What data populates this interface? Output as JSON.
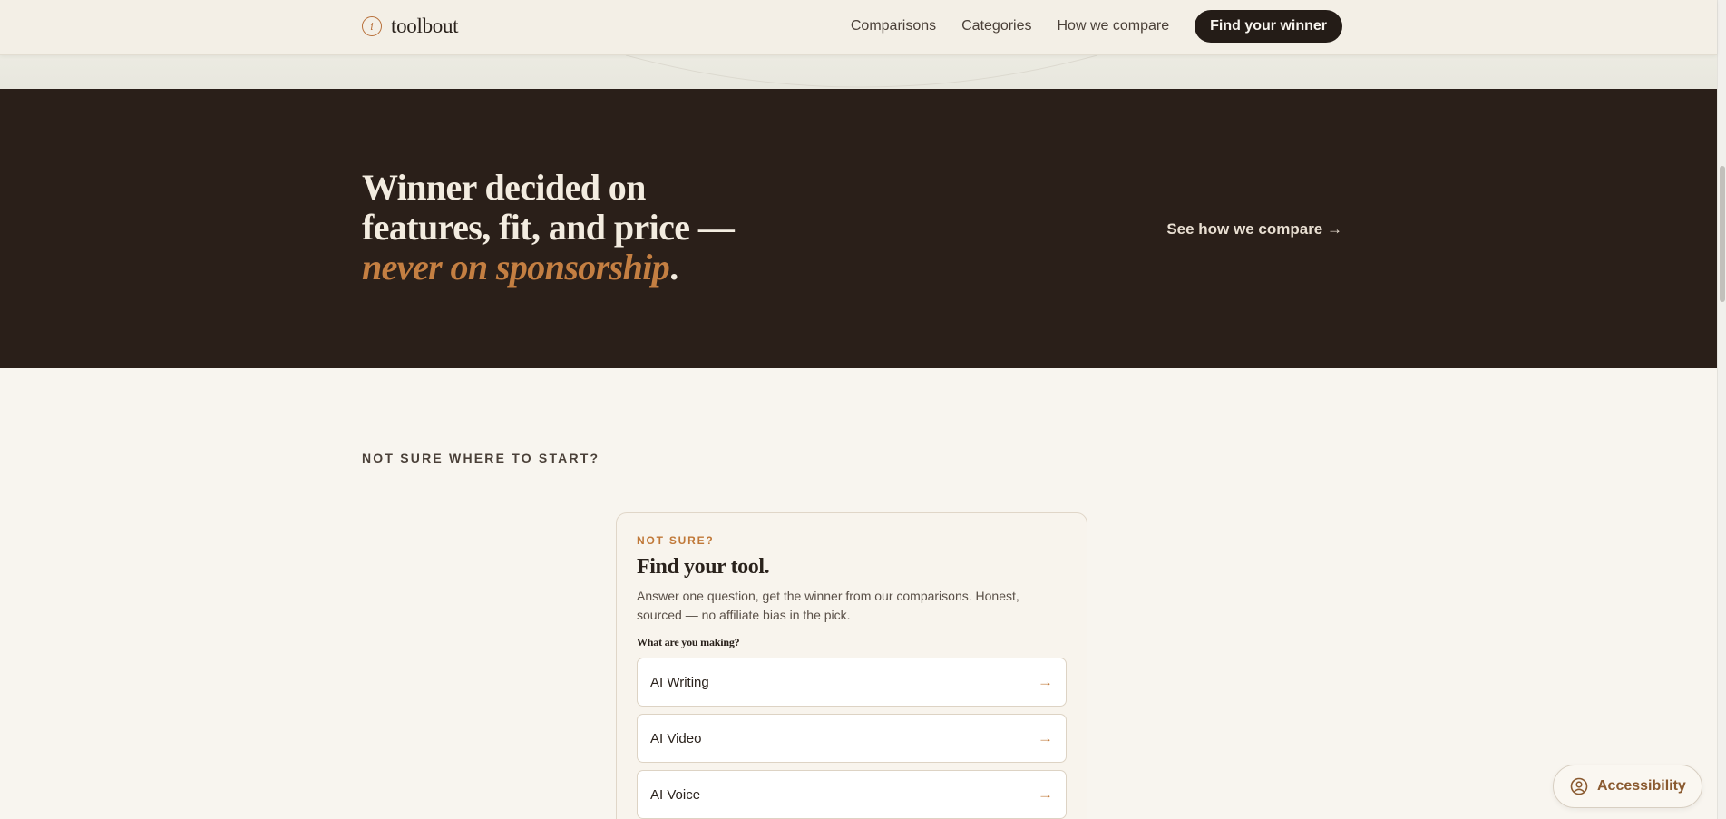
{
  "header": {
    "logo_mark": "i",
    "logo_text": "toolbout",
    "nav": {
      "comparisons": "Comparisons",
      "categories": "Categories",
      "how_we_compare": "How we compare",
      "cta": "Find your winner"
    }
  },
  "band": {
    "heading_line1": "Winner decided on features, fit, and price — ",
    "heading_accent": "never on sponsorship",
    "heading_end": ".",
    "link": "See how we compare →"
  },
  "finder": {
    "section_eyebrow": "NOT SURE WHERE TO START?",
    "eyebrow": "NOT SURE?",
    "title": "Find your tool.",
    "description": "Answer one question, get the winner from our comparisons. Honest, sourced — no affiliate bias in the pick.",
    "question": "What are you making?",
    "options": [
      {
        "label": "AI Writing",
        "arrow": "→"
      },
      {
        "label": "AI Video",
        "arrow": "→"
      },
      {
        "label": "AI Voice",
        "arrow": "→"
      }
    ]
  },
  "accessibility": {
    "label": "Accessibility",
    "icon": "person-circle-icon"
  },
  "colors": {
    "accent": "#c07838",
    "dark_band": "#2a1f19",
    "page_bg": "#f8f5ef"
  }
}
